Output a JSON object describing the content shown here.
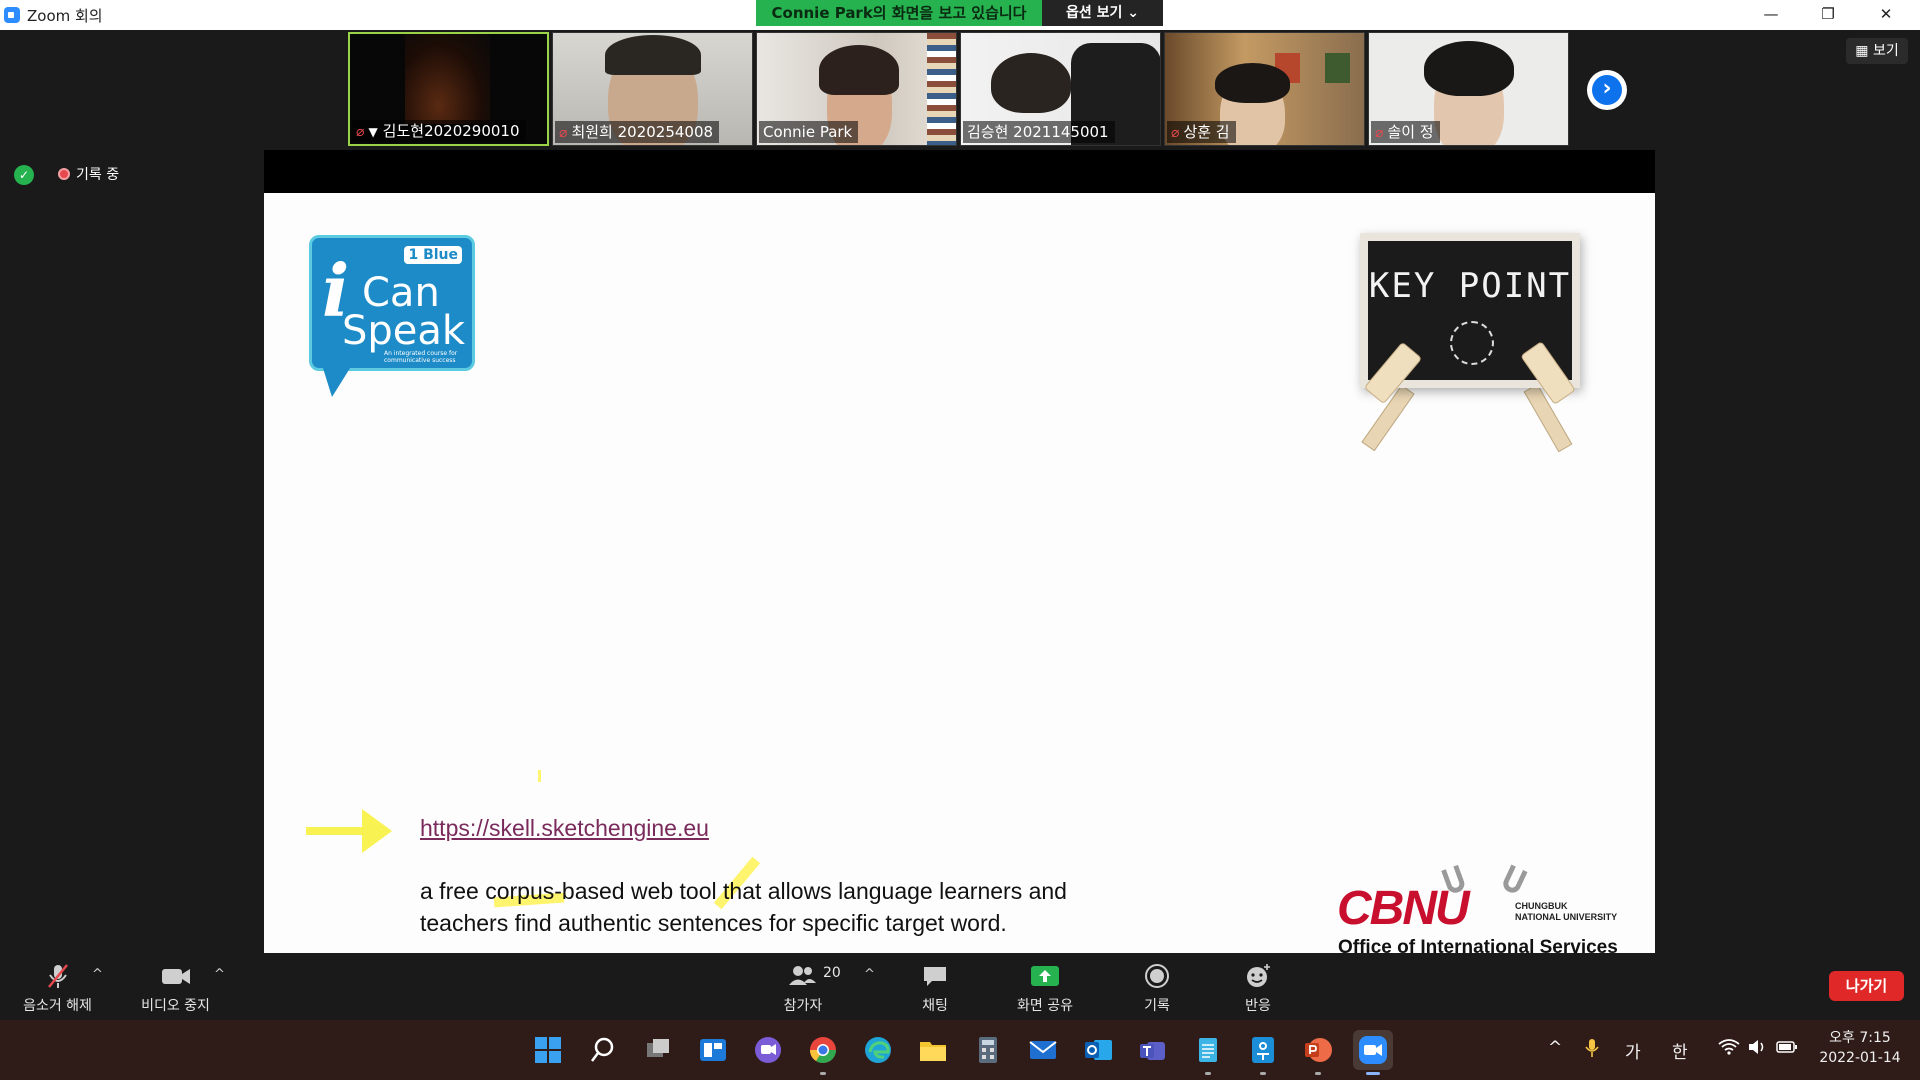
{
  "window": {
    "title": "Zoom 회의",
    "minimize_glyph": "—",
    "restore_glyph": "❐",
    "close_glyph": "✕"
  },
  "share_banner": {
    "text": "Connie Park의 화면을 보고 있습니다",
    "options_label": "옵션 보기 ⌄"
  },
  "participants": [
    {
      "name": "김도현2020290010",
      "muted": true,
      "pinned": true,
      "active": true
    },
    {
      "name": "최원희 2020254008",
      "muted": true,
      "pinned": false,
      "active": false
    },
    {
      "name": "Connie Park",
      "muted": false,
      "pinned": false,
      "active": false
    },
    {
      "name": "김승현 2021145001",
      "muted": false,
      "pinned": false,
      "active": false
    },
    {
      "name": "상훈 김",
      "muted": true,
      "pinned": false,
      "active": false
    },
    {
      "name": "솔이 정",
      "muted": true,
      "pinned": false,
      "active": false
    }
  ],
  "gallery": {
    "next_glyph": "›",
    "view_label": "보기"
  },
  "recording": {
    "label": "기록 중"
  },
  "slide": {
    "logo": {
      "badge": "1 Blue",
      "i": "i",
      "can": "Can",
      "speak": "Speak",
      "tagline": "An integrated course for communicative success"
    },
    "keypoint_text": "KEY POINT",
    "url": "https://skell.sketchengine.eu",
    "description_line1": "a free corpus-based web tool that allows language learners and",
    "description_line2": "teachers find authentic sentences for specific target word.",
    "cbnu": {
      "mark": "CBNU",
      "university_line1": "CHUNGBUK",
      "university_line2": "NATIONAL UNIVERSITY",
      "office": "Office of International Services"
    }
  },
  "toolbar": {
    "unmute_label": "음소거 해제",
    "video_label": "비디오 중지",
    "participants_label": "참가자",
    "participants_count": "20",
    "chat_label": "채팅",
    "share_label": "화면 공유",
    "record_label": "기록",
    "reactions_label": "반응",
    "leave_label": "나가기",
    "caret_glyph": "^"
  },
  "taskbar": {
    "ime_mode": "가",
    "ime_lang": "한",
    "time": "오후 7:15",
    "date": "2022-01-14",
    "tray_chevron": "^"
  },
  "colors": {
    "zoom_blue": "#0e72ed",
    "share_green": "#25b24f",
    "leave_red": "#e02828",
    "mute_red": "#e5484d"
  }
}
